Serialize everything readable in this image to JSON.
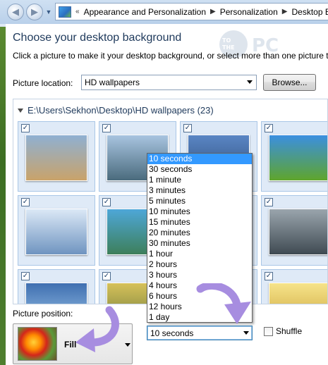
{
  "address_bar": {
    "crumbs": [
      "Appearance and Personalization",
      "Personalization",
      "Desktop B"
    ]
  },
  "watermark": "TO THE PC",
  "page": {
    "title": "Choose your desktop background",
    "subtitle": "Click a picture to make it your desktop background, or select more than one picture t"
  },
  "picture_location": {
    "label": "Picture location:",
    "value": "HD wallpapers",
    "browse_label": "Browse..."
  },
  "gallery": {
    "folder_path": "E:\\Users\\Sekhon\\Desktop\\HD wallpapers (23)",
    "thumbnails": [
      {
        "name": "landscape-clouds",
        "checked": true,
        "colors": [
          "#8fb0d2",
          "#c9a36a"
        ]
      },
      {
        "name": "rock-arch-sea",
        "checked": true,
        "colors": [
          "#a8c4e0",
          "#4a6b7d"
        ]
      },
      {
        "name": "stone-circle",
        "checked": true,
        "colors": [
          "#5a86c4",
          "#2f4e7d"
        ]
      },
      {
        "name": "green-field-sky",
        "checked": true,
        "colors": [
          "#3b8fe0",
          "#5fa52c"
        ]
      },
      {
        "name": "winter-trees",
        "checked": true,
        "colors": [
          "#dbe8f6",
          "#6f94c0"
        ]
      },
      {
        "name": "island-waterfall",
        "checked": true,
        "colors": [
          "#4ea7d8",
          "#3d7f5a"
        ]
      },
      {
        "name": "blue-abstract",
        "checked": true,
        "colors": [
          "#4f7bb5",
          "#1f3b66"
        ]
      },
      {
        "name": "misty-pillars",
        "checked": true,
        "colors": [
          "#9aa5ad",
          "#3f4a52"
        ]
      },
      {
        "name": "blue-light",
        "checked": true,
        "colors": [
          "#3f6fb0",
          "#9cc5ea"
        ]
      },
      {
        "name": "golden-sky",
        "checked": true,
        "colors": [
          "#d6c15a",
          "#6e7b3a"
        ]
      },
      {
        "name": "dusk-field",
        "checked": true,
        "colors": [
          "#6a7ea8",
          "#c7b37c"
        ]
      },
      {
        "name": "bright-sun",
        "checked": true,
        "colors": [
          "#f6e48a",
          "#cba43a"
        ]
      }
    ]
  },
  "interval_dropdown": {
    "options": [
      "10 seconds",
      "30 seconds",
      "1 minute",
      "3 minutes",
      "5 minutes",
      "10 minutes",
      "15 minutes",
      "20 minutes",
      "30 minutes",
      "1 hour",
      "2 hours",
      "3 hours",
      "4 hours",
      "6 hours",
      "12 hours",
      "1 day"
    ],
    "selected": "10 seconds"
  },
  "picture_position": {
    "label": "Picture position:",
    "value": "Fill"
  },
  "shuffle": {
    "label": "Shuffle",
    "checked": false
  },
  "colors": {
    "accent": "#3399ff",
    "annotation_arrow": "#a78de0",
    "title_text": "#1e395b"
  }
}
